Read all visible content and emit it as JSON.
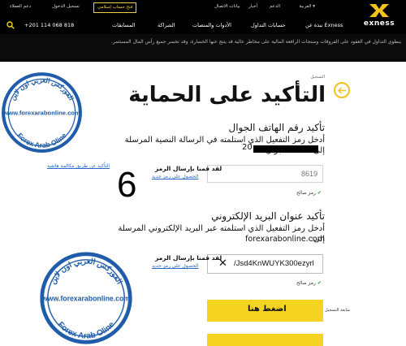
{
  "topbar": {
    "lang": "العربية ▾",
    "items": [
      "أخبار",
      "الدعم",
      "بيانات الاتصال"
    ],
    "open_islamic": "فتح حساب إسلامي",
    "login": "تسجيل الدخول",
    "personal": "دعم العملاء"
  },
  "navbar": {
    "items": [
      "نبذة عن Exness",
      "حسابات التداول",
      "الأدوات والمنصات",
      "الشراكة",
      "المسابقات"
    ],
    "phone": "+201 114 068 818"
  },
  "logo": {
    "name": "exness"
  },
  "disclaimer": {
    "text": "ينطوي التداول في العقود على الفروقات ومنتجات الرافعة المالية على مخاطر عالية قد ينتج عنها الخسارة، وقد تخسر جميع رأس المال المستثمر."
  },
  "form": {
    "breadcrumb": "التسجيل",
    "title": "التأكيد على الحماية",
    "phone_section": {
      "title": "تأكيد رقم الهاتف الجوال",
      "desc": "أدخل رمز التفعيل الذي استلمته في الرسالة النصية المرسلة إلى هاتفك الجوال:",
      "number_prefix": "20",
      "code_placeholder": "8619",
      "valid": "رمز صالح",
      "resend_label": "لقد قمنا بإرسال الرمز",
      "resend_link": "الحصول على رمز جديد",
      "voice_link": "التأكيد عن طريق مكالمة هاتفية"
    },
    "email_section": {
      "title": "تأكيد عنوان البريد الإلكتروني",
      "desc": "أدخل رمز التفعيل الذي استلمته عبر البريد الإلكتروني المرسلة إلى:",
      "email": "forexarabonline.com",
      "code_value": "/Jsd4KnWUYK300ezyrl",
      "valid": "رمز صالح",
      "resend_label": "لقد قمنا بإرسال الرمز",
      "resend_link": "الحصول على رمز جديد"
    },
    "step_number": "6",
    "submit_label": "اضغط هنا",
    "terms": "متابعة التسجيل"
  },
  "watermark": {
    "arabic": "الفوركس العربي اون لاين",
    "url": "www.forexarabonline.com",
    "english": "Forex Arab Oline"
  },
  "colors": {
    "accent": "#f4d321",
    "link": "#2867c6",
    "watermark": "#1f5ca9",
    "header": "#000000"
  }
}
